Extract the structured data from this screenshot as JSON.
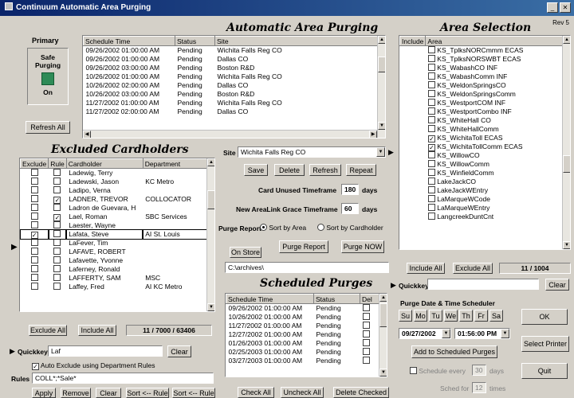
{
  "window": {
    "title": "Continuum Automatic Area Purging",
    "revision": "Rev 5"
  },
  "primary": {
    "label": "Primary",
    "mode_label": "Safe Purging",
    "state": "On",
    "refresh_label": "Refresh All"
  },
  "auto_purge": {
    "heading": "Automatic Area Purging",
    "columns": [
      "Schedule Time",
      "Status",
      "Site"
    ],
    "rows": [
      [
        "09/26/2002 01:00:00 AM",
        "Pending",
        "Wichita Falls Reg CO"
      ],
      [
        "09/26/2002 01:00:00 AM",
        "Pending",
        "Dallas CO"
      ],
      [
        "09/26/2002 03:00:00 AM",
        "Pending",
        "Boston R&D"
      ],
      [
        "10/26/2002 01:00:00 AM",
        "Pending",
        "Wichita Falls Reg CO"
      ],
      [
        "10/26/2002 02:00:00 AM",
        "Pending",
        "Dallas CO"
      ],
      [
        "10/26/2002 03:00:00 AM",
        "Pending",
        "Boston R&D"
      ],
      [
        "11/27/2002 01:00:00 AM",
        "Pending",
        "Wichita Falls Reg CO"
      ],
      [
        "11/27/2002 02:00:00 AM",
        "Pending",
        "Dallas CO"
      ]
    ]
  },
  "area_selection": {
    "heading": "Area Selection",
    "columns": [
      "Include",
      "Area"
    ],
    "items": [
      {
        "checked": false,
        "name": "KS_TplksNORCmmm ECAS"
      },
      {
        "checked": false,
        "name": "KS_TplksNORSWBT ECAS"
      },
      {
        "checked": false,
        "name": "KS_WabashCO INF"
      },
      {
        "checked": false,
        "name": "KS_WabashComm INF"
      },
      {
        "checked": false,
        "name": "KS_WeldonSpringsCO"
      },
      {
        "checked": false,
        "name": "KS_WeldonSpringsComm"
      },
      {
        "checked": false,
        "name": "KS_WestportCOM INF"
      },
      {
        "checked": false,
        "name": "KS_WestportCombo INF"
      },
      {
        "checked": false,
        "name": "KS_WhiteHall CO"
      },
      {
        "checked": false,
        "name": "KS_WhiteHallComm"
      },
      {
        "checked": true,
        "name": "KS_WichitaToll ECAS"
      },
      {
        "checked": true,
        "name": "KS_WichitaTollComm ECAS"
      },
      {
        "checked": false,
        "name": "KS_WillowCO"
      },
      {
        "checked": false,
        "name": "KS_WillowComm"
      },
      {
        "checked": false,
        "name": "KS_WinfieldComm"
      },
      {
        "checked": false,
        "name": "LakeJackCO"
      },
      {
        "checked": false,
        "name": "LakeJackWEntry"
      },
      {
        "checked": false,
        "name": "LaMarqueWCode"
      },
      {
        "checked": false,
        "name": "LaMarqueWEntry"
      },
      {
        "checked": false,
        "name": "LangcreekDuntCnt"
      }
    ],
    "include_all": "Include All",
    "exclude_all": "Exclude All",
    "count": "11 / 1004",
    "quickkey_label": "Quickkey",
    "quickkey_value": "",
    "clear_label": "Clear"
  },
  "excluded": {
    "heading": "Excluded Cardholders",
    "columns": [
      "Exclude",
      "Rule",
      "Cardholder",
      "Department"
    ],
    "rows": [
      {
        "ex": false,
        "rule": false,
        "name": "Ladewig, Terry",
        "dept": ""
      },
      {
        "ex": false,
        "rule": false,
        "name": "Ladewski, Jason",
        "dept": "KC Metro"
      },
      {
        "ex": false,
        "rule": false,
        "name": "Ladipo, Verna",
        "dept": ""
      },
      {
        "ex": false,
        "rule": true,
        "name": "LADNER, TREVOR",
        "dept": "COLLOCATOR"
      },
      {
        "ex": false,
        "rule": false,
        "name": "Ladron de Guevara, H",
        "dept": ""
      },
      {
        "ex": false,
        "rule": true,
        "name": "Lael, Roman",
        "dept": "SBC Services"
      },
      {
        "ex": false,
        "rule": false,
        "name": "Laester, Wayne",
        "dept": ""
      },
      {
        "ex": true,
        "rule": false,
        "name": "Lafata, Steve",
        "dept": "AI St. Louis"
      },
      {
        "ex": false,
        "rule": false,
        "name": "LaFever, Tim",
        "dept": ""
      },
      {
        "ex": false,
        "rule": false,
        "name": "LAFAVE, ROBERT",
        "dept": ""
      },
      {
        "ex": false,
        "rule": false,
        "name": "Lafavette, Yvonne",
        "dept": ""
      },
      {
        "ex": false,
        "rule": false,
        "name": "Laferney, Ronald",
        "dept": ""
      },
      {
        "ex": false,
        "rule": false,
        "name": "LAFFERTY, SAM",
        "dept": "MSC"
      },
      {
        "ex": false,
        "rule": false,
        "name": "Laffey, Fred",
        "dept": "AI KC Metro"
      }
    ],
    "exclude_all": "Exclude All",
    "include_all": "Include All",
    "count": "11 / 7000 / 63406",
    "quickkey_label": "Quickkey",
    "quickkey_value": "Laf",
    "clear_label": "Clear",
    "auto_exclude_label": "Auto Exclude using Department Rules",
    "rules_label": "Rules",
    "rules_value": "COLL*;*Sale*",
    "buttons": [
      "Apply",
      "Remove",
      "Clear",
      "Sort <-- Rule",
      "Sort <-- Rule"
    ]
  },
  "site_panel": {
    "site_label": "Site",
    "site_value": "Wichita Falls Reg CO",
    "buttons": [
      "Save",
      "Delete",
      "Refresh",
      "Repeat"
    ],
    "card_unused_label": "Card Unused Timeframe",
    "card_unused_value": "180",
    "new_link_label": "New AreaLink Grace Timeframe",
    "new_link_value": "60",
    "days": "days",
    "purge_report_label": "Purge Report",
    "sort_area": "Sort by Area",
    "sort_cardholder": "Sort by Cardholder",
    "on_store": "On Store",
    "purge_report_btn": "Purge Report",
    "purge_now_btn": "Purge NOW",
    "file_path": "C:\\archives\\"
  },
  "scheduled": {
    "heading": "Scheduled Purges",
    "columns": [
      "Schedule Time",
      "Status",
      "Del"
    ],
    "rows": [
      [
        "09/26/2002 01:00:00 AM",
        "Pending"
      ],
      [
        "10/26/2002 01:00:00 AM",
        "Pending"
      ],
      [
        "11/27/2002 01:00:00 AM",
        "Pending"
      ],
      [
        "12/27/2002 01:00:00 AM",
        "Pending"
      ],
      [
        "01/26/2003 01:00:00 AM",
        "Pending"
      ],
      [
        "02/25/2003 01:00:00 AM",
        "Pending"
      ],
      [
        "03/27/2003 01:00:00 AM",
        "Pending"
      ]
    ],
    "check_all": "Check All",
    "uncheck_all": "Uncheck All",
    "delete_checked": "Delete Checked"
  },
  "scheduler": {
    "heading": "Purge Date & Time Scheduler",
    "days": [
      "Su",
      "Mo",
      "Tu",
      "We",
      "Th",
      "Fr",
      "Sa"
    ],
    "date_value": "09/27/2002",
    "time_value": "01:56:00 PM",
    "add_label": "Add to Scheduled Purges",
    "schedule_every_label": "Schedule every",
    "schedule_every_value": "30",
    "schedule_every_unit": "days",
    "sched_for_label": "Sched for",
    "sched_for_value": "12",
    "sched_for_unit": "times"
  },
  "right_buttons": {
    "ok": "OK",
    "select_printer": "Select Printer",
    "quit": "Quit"
  }
}
